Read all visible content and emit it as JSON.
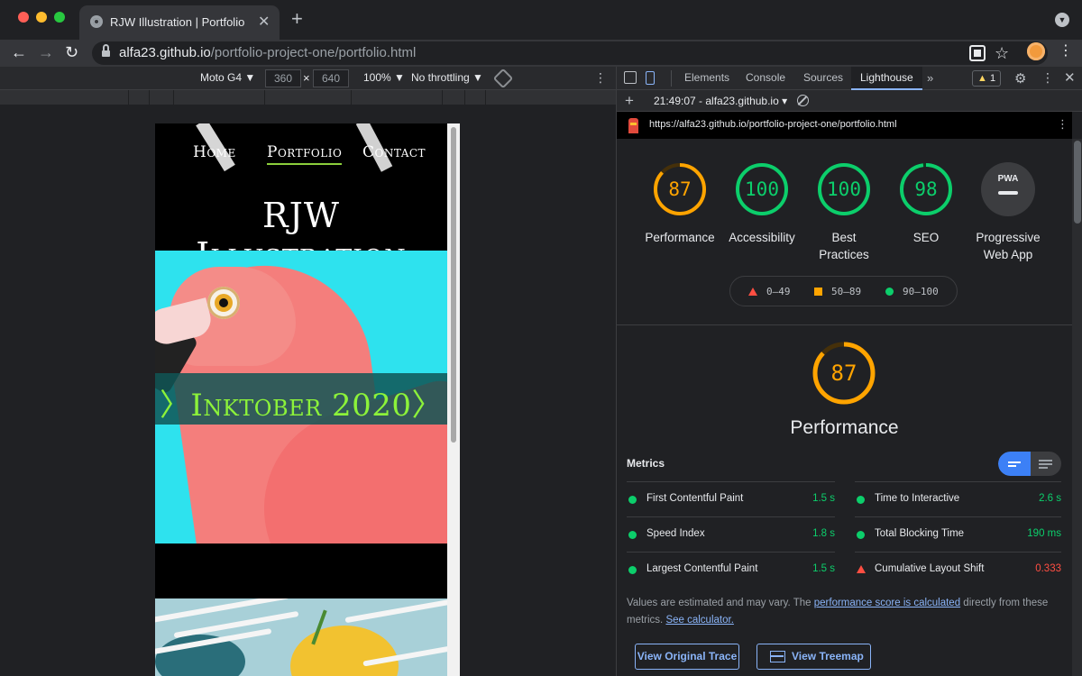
{
  "browser": {
    "tab_title": "RJW Illustration | Portfolio",
    "close_glyph": "✕",
    "newtab_glyph": "+",
    "url_host": "alfa23.github.io",
    "url_path": "/portfolio-project-one/portfolio.html",
    "back_glyph": "←",
    "forward_glyph": "→",
    "reload_glyph": "↻",
    "star_glyph": "☆",
    "menu_glyph": "⋮"
  },
  "device_toolbar": {
    "device": "Moto G4 ▼",
    "width": "360",
    "times": "×",
    "height": "640",
    "zoom": "100% ▼",
    "throttling": "No throttling ▼",
    "more": "⋮"
  },
  "site": {
    "nav": [
      "Home",
      "Portfolio",
      "Contact"
    ],
    "title": "RJW Illustration",
    "hero_banner": "〉Inktober 2020〉"
  },
  "devtools": {
    "tabs": [
      "Elements",
      "Console",
      "Sources",
      "Lighthouse"
    ],
    "active_tab": "Lighthouse",
    "more_tabs": "»",
    "warnings": "1",
    "warn_glyph": "▲",
    "gear": "⚙",
    "dots": "⋮",
    "close": "✕",
    "report_plus": "+",
    "report_time": "21:49:07 - alfa23.github.io ▾"
  },
  "lighthouse": {
    "url": "https://alfa23.github.io/portfolio-project-one/portfolio.html",
    "url_menu": "⋮",
    "colors": {
      "pass": "#0cce6b",
      "average": "#ffa400",
      "fail": "#ff4e42"
    },
    "categories": [
      {
        "label": "Performance",
        "score": 87,
        "status": "average"
      },
      {
        "label": "Accessibility",
        "score": 100,
        "status": "pass"
      },
      {
        "label": "Best Practices",
        "score": 100,
        "status": "pass"
      },
      {
        "label": "SEO",
        "score": 98,
        "status": "pass"
      }
    ],
    "pwa": {
      "label": "Progressive Web App",
      "badge": "PWA"
    },
    "legend": [
      "0–49",
      "50–89",
      "90–100"
    ],
    "performance": {
      "score": "87",
      "title": "Performance"
    },
    "metrics_heading": "Metrics",
    "metrics": [
      {
        "name": "First Contentful Paint",
        "value": "1.5 s",
        "status": "pass"
      },
      {
        "name": "Time to Interactive",
        "value": "2.6 s",
        "status": "pass"
      },
      {
        "name": "Speed Index",
        "value": "1.8 s",
        "status": "pass"
      },
      {
        "name": "Total Blocking Time",
        "value": "190 ms",
        "status": "pass"
      },
      {
        "name": "Largest Contentful Paint",
        "value": "1.5 s",
        "status": "pass"
      },
      {
        "name": "Cumulative Layout Shift",
        "value": "0.333",
        "status": "fail"
      }
    ],
    "note": {
      "prefix": "Values are estimated and may vary. The ",
      "link1": "performance score is calculated",
      "middle": " directly from these metrics. ",
      "link2": "See calculator."
    },
    "buttons": {
      "trace": "View Original Trace",
      "treemap": "View Treemap"
    }
  }
}
